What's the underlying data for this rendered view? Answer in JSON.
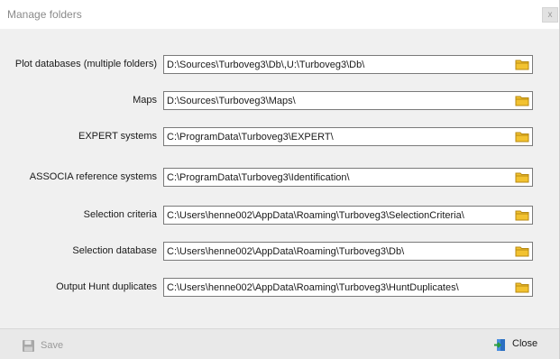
{
  "window": {
    "title": "Manage folders",
    "close_glyph": "x"
  },
  "folders": [
    {
      "label": "Plot databases (multiple folders)",
      "value": "D:\\Sources\\Turboveg3\\Db\\,U:\\Turboveg3\\Db\\"
    },
    {
      "label": "Maps",
      "value": "D:\\Sources\\Turboveg3\\Maps\\"
    },
    {
      "label": "EXPERT systems",
      "value": "C:\\ProgramData\\Turboveg3\\EXPERT\\"
    },
    {
      "label": "ASSOCIA reference systems",
      "value": "C:\\ProgramData\\Turboveg3\\Identification\\"
    },
    {
      "label": "Selection criteria",
      "value": "C:\\Users\\henne002\\AppData\\Roaming\\Turboveg3\\SelectionCriteria\\"
    },
    {
      "label": "Selection database",
      "value": "C:\\Users\\henne002\\AppData\\Roaming\\Turboveg3\\Db\\"
    },
    {
      "label": "Output Hunt duplicates",
      "value": "C:\\Users\\henne002\\AppData\\Roaming\\Turboveg3\\HuntDuplicates\\"
    }
  ],
  "footer": {
    "save_label": "Save",
    "close_label": "Close"
  },
  "icons": {
    "folder": "folder-icon",
    "save": "floppy-disk-icon",
    "close": "exit-door-icon"
  },
  "colors": {
    "folder_fill": "#f2c230",
    "folder_edge": "#b88a12",
    "disabled_text": "#9a9a9a"
  }
}
